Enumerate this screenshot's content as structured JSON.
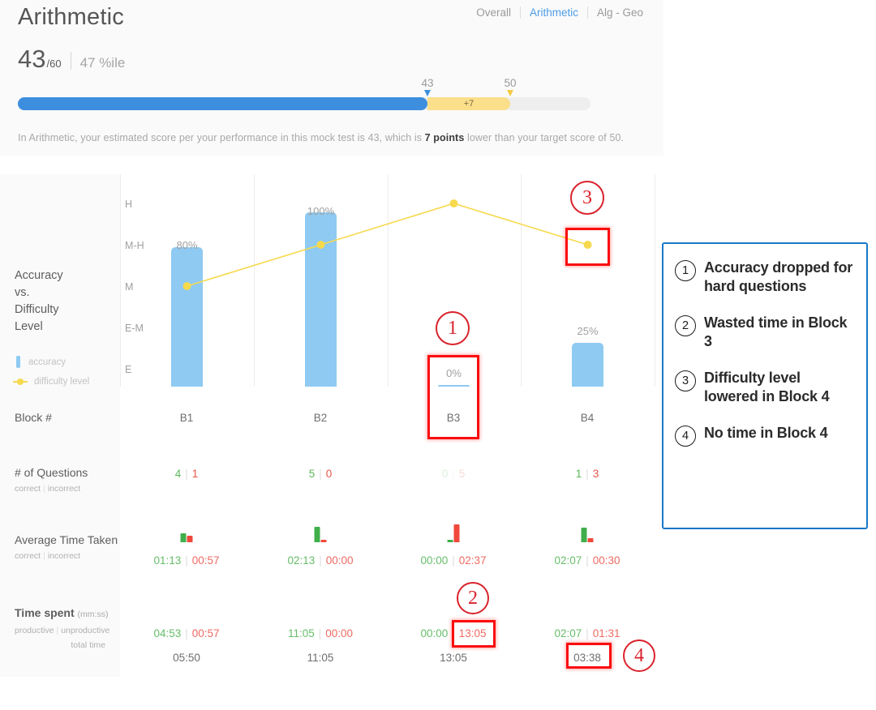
{
  "header": {
    "title": "Arithmetic",
    "tabs": [
      {
        "label": "Overall",
        "active": false
      },
      {
        "label": "Arithmetic",
        "active": true
      },
      {
        "label": "Alg - Geo",
        "active": false
      }
    ],
    "score": "43",
    "score_denominator": "/60",
    "percentile": "47 %ile",
    "progress": {
      "current_marker": "43",
      "target_marker": "50",
      "gap_label": "+7",
      "blue_color": "#3d8ede",
      "yellow_color": "#fbdf8b",
      "track_color": "#eeeeee"
    },
    "footnote_pre": "In Arithmetic, your estimated score per your performance in this mock test is 43, which is ",
    "footnote_bold": "7 points",
    "footnote_post": " lower than your target score of 50."
  },
  "chart_data": {
    "type": "bar",
    "title": "Accuracy vs. Difficulty Level",
    "categories": [
      "B1",
      "B2",
      "B3",
      "B4"
    ],
    "xlabel": "Block #",
    "ylabel": "accuracy",
    "ylim": [
      0,
      100
    ],
    "grid": true,
    "legend_position": "left",
    "series": [
      {
        "name": "accuracy",
        "type": "bar",
        "color": "#8ecaf2",
        "values": [
          80,
          100,
          0,
          25
        ],
        "labels": [
          "80%",
          "100%",
          "0%",
          "25%"
        ]
      },
      {
        "name": "difficulty level",
        "type": "line",
        "color": "#f7d94e",
        "values": [
          "M",
          "M-H",
          "H",
          "M-H"
        ],
        "y_ticks": [
          "H",
          "M-H",
          "M",
          "E-M",
          "E"
        ]
      }
    ],
    "y_categories": [
      "H",
      "M-H",
      "M",
      "E-M",
      "E"
    ]
  },
  "chart": {
    "title_lines": [
      "Accuracy",
      "vs.",
      "Difficulty",
      "Level"
    ],
    "legend": {
      "accuracy": "accuracy",
      "difficulty": "difficulty level"
    },
    "y_axis": [
      "H",
      "M-H",
      "M",
      "E-M",
      "E"
    ],
    "bar_labels": [
      "80%",
      "100%",
      "0%",
      "25%"
    ]
  },
  "table": {
    "rows": [
      {
        "id": "block",
        "label": "Block #",
        "sublabel": "",
        "values": [
          "B1",
          "B2",
          "B3",
          "B4"
        ]
      },
      {
        "id": "questions",
        "label": "# of Questions",
        "sublabel_a": "correct",
        "sublabel_b": "incorrect",
        "correct": [
          "4",
          "5",
          "0",
          "1"
        ],
        "incorrect": [
          "1",
          "0",
          "5",
          "3"
        ],
        "faded": [
          false,
          false,
          true,
          false
        ]
      },
      {
        "id": "avg_time",
        "label": "Average Time Taken",
        "sublabel_a": "correct",
        "sublabel_b": "incorrect",
        "correct": [
          "01:13",
          "02:13",
          "00:00",
          "02:07"
        ],
        "incorrect": [
          "00:57",
          "00:00",
          "02:37",
          "00:30"
        ]
      },
      {
        "id": "time_spent",
        "label": "Time spent",
        "label_unit": "(mm:ss)",
        "sublabel_a": "productive",
        "sublabel_b": "unproductive",
        "sublabel_c": "total time",
        "productive": [
          "04:53",
          "11:05",
          "00:00",
          "02:07"
        ],
        "unproductive": [
          "00:57",
          "00:00",
          "13:05",
          "01:31"
        ],
        "total": [
          "05:50",
          "11:05",
          "13:05",
          "03:38"
        ]
      }
    ]
  },
  "notes": {
    "border_color": "#1878c8",
    "items": [
      {
        "num": "1",
        "text": "Accuracy dropped for hard questions"
      },
      {
        "num": "2",
        "text": "Wasted time in Block 3"
      },
      {
        "num": "3",
        "text": "Difficulty level lowered in Block 4"
      },
      {
        "num": "4",
        "text": "No time in Block 4"
      }
    ]
  },
  "annotations": {
    "marker_color": "#d9232c",
    "box_color": "#fb0d0d",
    "markers": [
      "1",
      "2",
      "3",
      "4"
    ]
  }
}
